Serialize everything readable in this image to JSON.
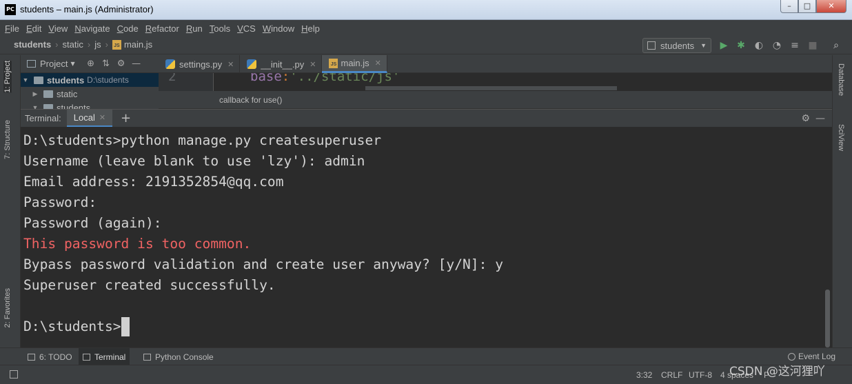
{
  "window": {
    "app_icon": "PC",
    "title": "students – main.js (Administrator)",
    "minimize_icon": "–",
    "maximize_icon": "□",
    "close_icon": "✕"
  },
  "menu": [
    "File",
    "Edit",
    "View",
    "Navigate",
    "Code",
    "Refactor",
    "Run",
    "Tools",
    "VCS",
    "Window",
    "Help"
  ],
  "breadcrumb": [
    "students",
    "static",
    "js",
    "main.js"
  ],
  "run_config": {
    "label": "students"
  },
  "toolbar_icons": [
    "run-icon",
    "debug-icon",
    "coverage-icon",
    "profile-icon",
    "concurrency-icon",
    "stop-icon",
    "search-icon"
  ],
  "project_panel": {
    "label": "Project",
    "tree": [
      {
        "name": "students",
        "path": "D:\\students",
        "expanded": true,
        "selected": true
      },
      {
        "name": "static",
        "expanded": false
      },
      {
        "name": "students",
        "expanded": true
      }
    ]
  },
  "left_tabs": [
    "1: Project",
    "7: Structure",
    "2: Favorites"
  ],
  "right_tabs": [
    "Database",
    "SciView"
  ],
  "editor_tabs": [
    {
      "label": "settings.py",
      "type": "py",
      "active": false
    },
    {
      "label": "__init__.py",
      "type": "py",
      "active": false
    },
    {
      "label": "main.js",
      "type": "js",
      "active": true
    }
  ],
  "editor": {
    "line_number": "2",
    "code_key": "base",
    "code_colon": ":",
    "code_string": "'../static/js'",
    "hint": "callback for use()"
  },
  "terminal": {
    "header_label": "Terminal:",
    "tab_label": "Local",
    "lines": [
      {
        "text": "D:\\students>python manage.py createsuperuser",
        "error": false
      },
      {
        "text": "Username (leave blank to use 'lzy'): admin",
        "error": false
      },
      {
        "text": "Email address: 2191352854@qq.com",
        "error": false
      },
      {
        "text": "Password:",
        "error": false
      },
      {
        "text": "Password (again):",
        "error": false
      },
      {
        "text": "This password is too common.",
        "error": true
      },
      {
        "text": "Bypass password validation and create user anyway? [y/N]: y",
        "error": false
      },
      {
        "text": "Superuser created successfully.",
        "error": false
      },
      {
        "text": "",
        "error": false
      }
    ],
    "prompt": "D:\\students>"
  },
  "bottom_tabs": [
    {
      "label": "6: TODO",
      "active": false
    },
    {
      "label": "Terminal",
      "active": true
    },
    {
      "label": "Python Console",
      "active": false
    }
  ],
  "event_log": "Event Log",
  "status": {
    "position": "3:32",
    "line_sep": "CRLF",
    "encoding": "UTF-8",
    "indent": "4 spaces",
    "extra": "P"
  },
  "watermark": "CSDN @这河狸吖"
}
